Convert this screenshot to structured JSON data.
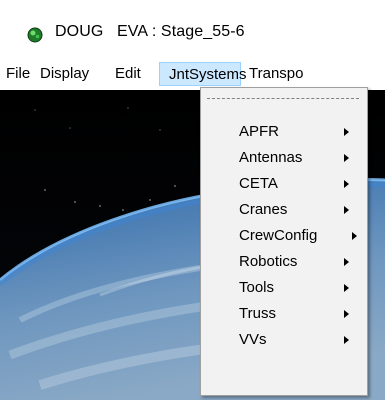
{
  "window": {
    "title": "DOUG   EVA : Stage_55-6",
    "icon": "doug-app-icon"
  },
  "menubar": {
    "items": [
      {
        "label": "File"
      },
      {
        "label": "Display"
      },
      {
        "label": "Edit"
      },
      {
        "label": "JntSystems"
      },
      {
        "label": "Transpo"
      }
    ],
    "active_item": "JntSystems",
    "active_color": "#cce8ff"
  },
  "dropdown": {
    "tearoff_icon": "tearoff-dashed-line",
    "submenu_icon": "submenu-arrow-icon",
    "items": [
      {
        "label": "APFR"
      },
      {
        "label": "Antennas"
      },
      {
        "label": "CETA"
      },
      {
        "label": "Cranes"
      },
      {
        "label": "CrewConfig"
      },
      {
        "label": "Robotics"
      },
      {
        "label": "Tools"
      },
      {
        "label": "Truss"
      },
      {
        "label": "VVs"
      }
    ]
  },
  "colors": {
    "space": "#000000",
    "earth_atmosphere": "#3a7fc8",
    "earth_surface": "#4f7fb0",
    "menu_background": "#f2f2f2"
  }
}
